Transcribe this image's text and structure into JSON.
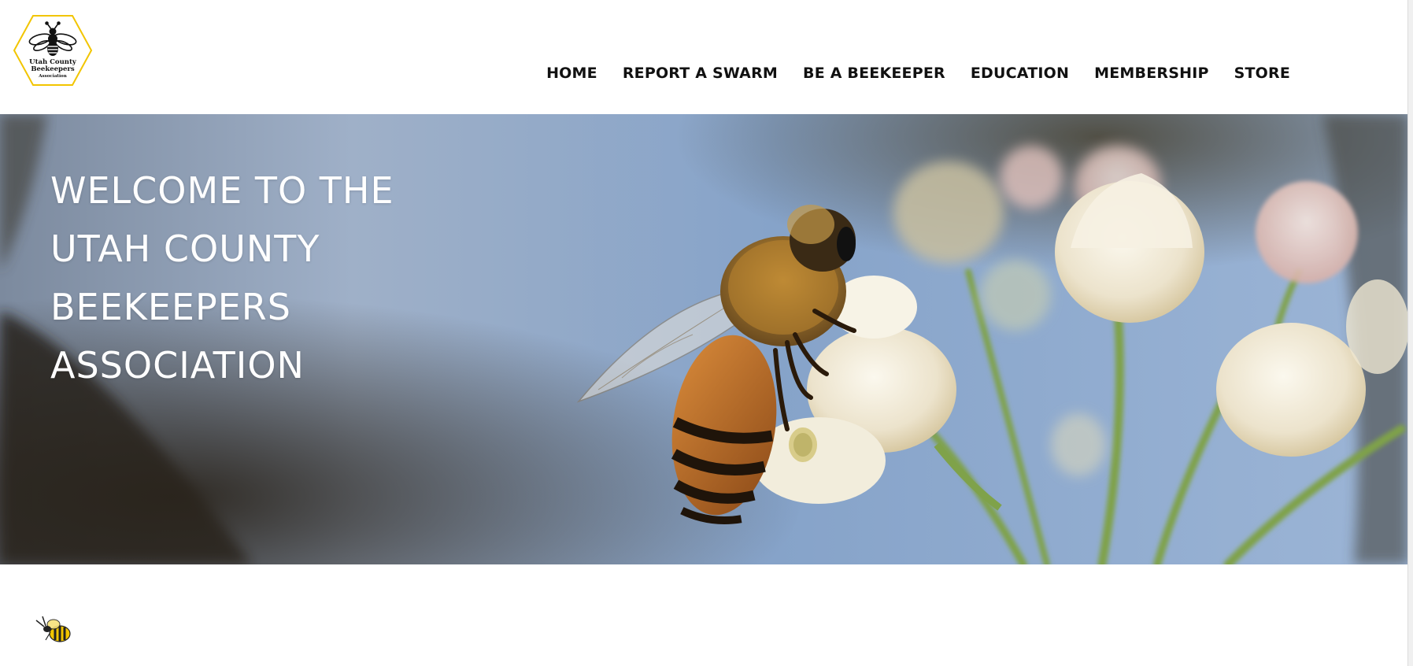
{
  "logo": {
    "line1": "Utah County",
    "line2": "Beekeepers",
    "line3": "Association"
  },
  "nav": {
    "items": [
      {
        "label": "HOME"
      },
      {
        "label": "REPORT A SWARM"
      },
      {
        "label": "BE A BEEKEEPER"
      },
      {
        "label": "EDUCATION"
      },
      {
        "label": "MEMBERSHIP"
      },
      {
        "label": "STORE"
      }
    ]
  },
  "hero": {
    "title_lines": [
      "WELCOME TO THE",
      "UTAH COUNTY",
      "BEEKEEPERS",
      "ASSOCIATION"
    ]
  },
  "colors": {
    "logo_border": "#f2c500",
    "nav_text": "#111111",
    "hero_text": "#ffffff",
    "sky": "#8fa6c4"
  },
  "icons": {
    "logo": "bee-hexagon-logo",
    "bottom": "bee-icon"
  }
}
